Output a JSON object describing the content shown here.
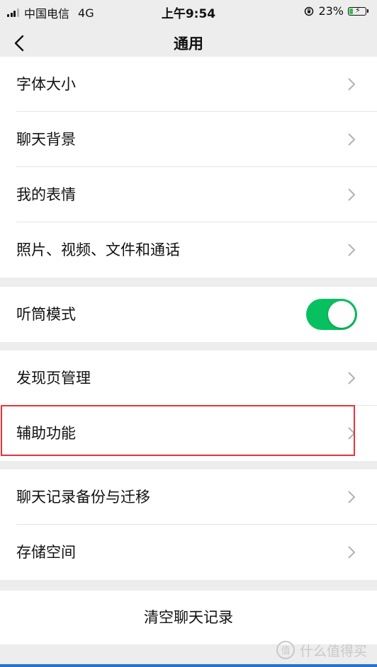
{
  "status_bar": {
    "carrier": "中国电信",
    "network": "4G",
    "time": "上午9:54",
    "battery_percent": "23%",
    "battery_level": 0.23
  },
  "nav": {
    "title": "通用"
  },
  "sections": {
    "display": [
      "字体大小",
      "聊天背景",
      "我的表情",
      "照片、视频、文件和通话"
    ],
    "earpiece": {
      "label": "听筒模式",
      "on": true
    },
    "features": [
      "发现页管理",
      "辅助功能"
    ],
    "storage": [
      "聊天记录备份与迁移",
      "存储空间"
    ]
  },
  "clear_chat": "清空聊天记录",
  "watermark": "什么值得买",
  "colors": {
    "toggle_on": "#07c160",
    "highlight": "#e8333c",
    "background": "#ededed"
  }
}
